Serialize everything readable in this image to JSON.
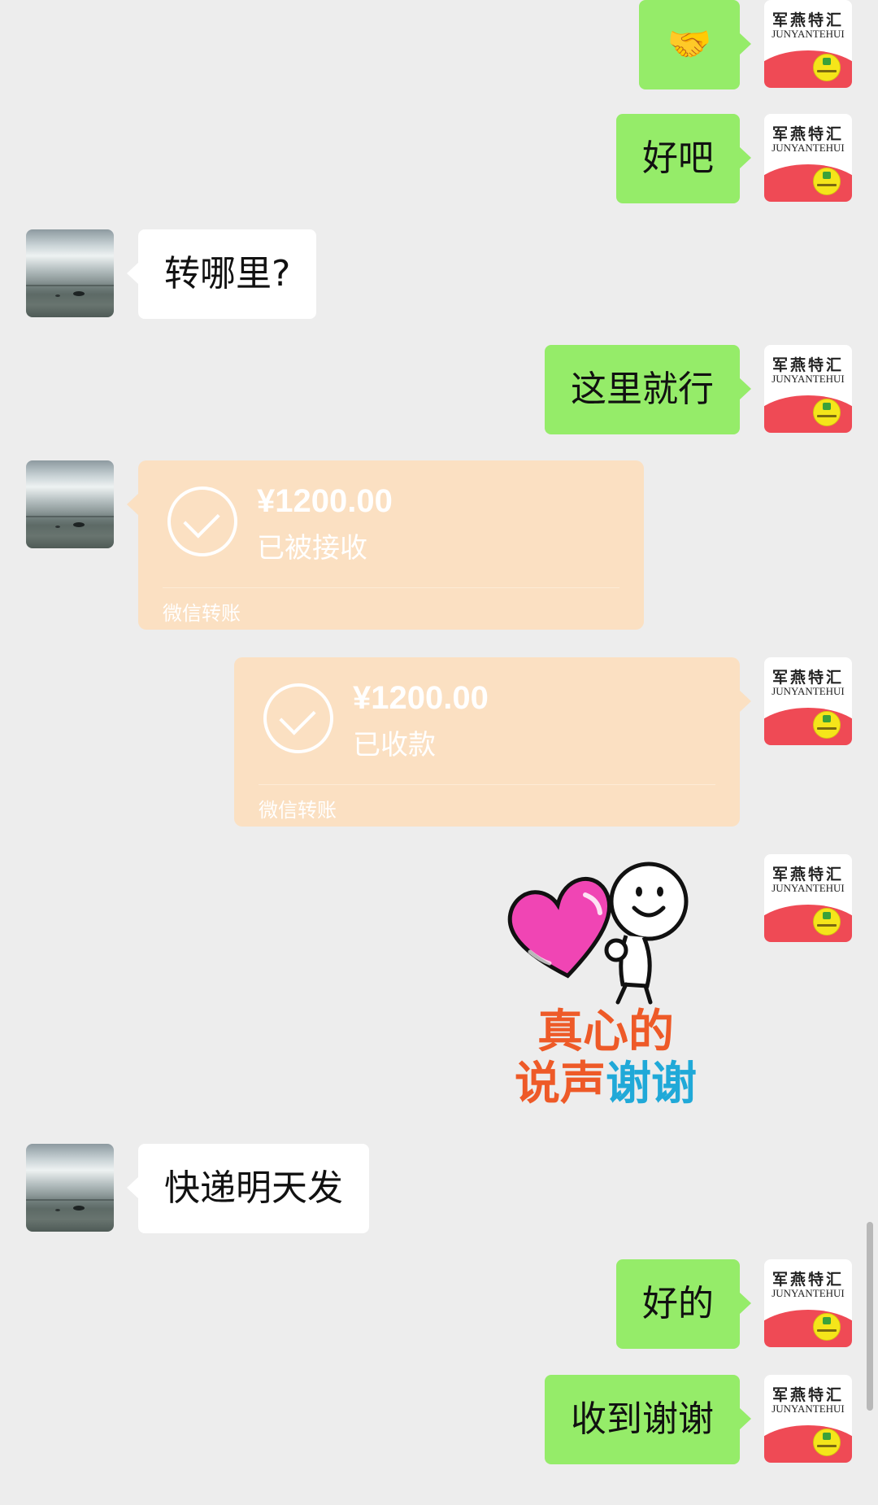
{
  "self_avatar": {
    "title_cn": "军燕特汇",
    "title_en": "JUNYANTEHUI"
  },
  "messages": {
    "m1": "🤝",
    "m2": "好吧",
    "m3": "转哪里?",
    "m4": "这里就行",
    "m8": "快递明天发",
    "m9": "好的",
    "m10": "收到谢谢"
  },
  "transfer_received": {
    "amount": "¥1200.00",
    "status": "已被接收",
    "footer": "微信转账"
  },
  "transfer_collected": {
    "amount": "¥1200.00",
    "status": "已收款",
    "footer": "微信转账"
  },
  "sticker": {
    "line1": "真心的",
    "line2_a": "说声",
    "line2_b": "谢谢",
    "colors": {
      "heart": "#f045b4",
      "text_orange": "#ee5a28",
      "text_blue": "#20a9d8"
    }
  },
  "colors": {
    "background": "#ededed",
    "self_bubble": "#95ec69",
    "other_bubble": "#ffffff",
    "transfer_card": "#fbe0c2",
    "avatar_red": "#ef4a55"
  }
}
